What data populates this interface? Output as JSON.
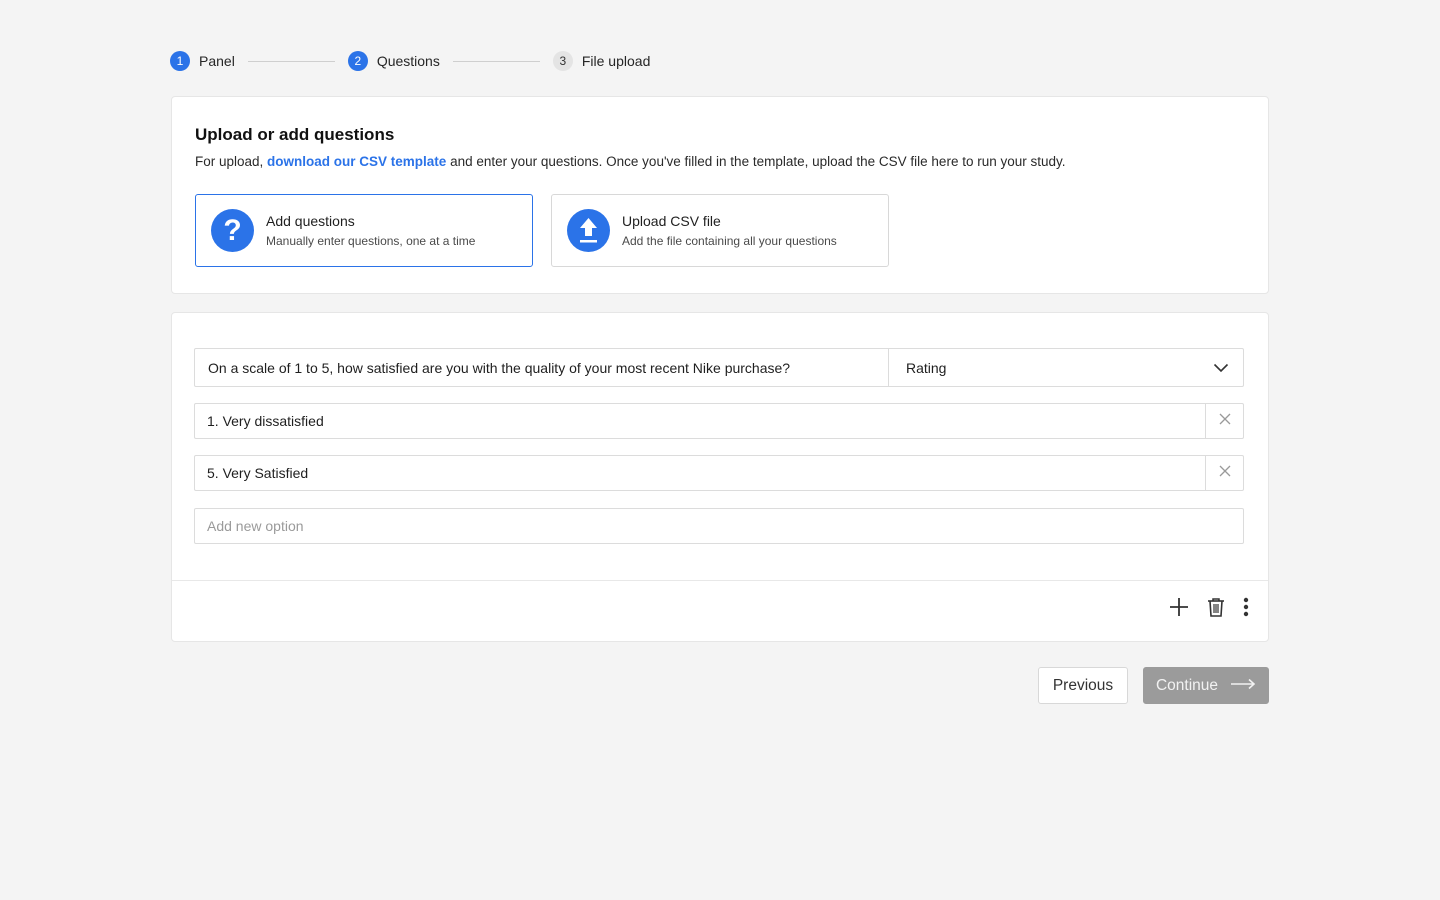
{
  "stepper": {
    "steps": [
      {
        "num": "1",
        "label": "Panel"
      },
      {
        "num": "2",
        "label": "Questions"
      },
      {
        "num": "3",
        "label": "File upload"
      }
    ]
  },
  "upload_card": {
    "title": "Upload or add questions",
    "desc_prefix": "For upload, ",
    "desc_link": "download our CSV template",
    "desc_suffix": " and enter your questions. Once you've filled in the template, upload the CSV file here to run your study.",
    "options": [
      {
        "title": "Add questions",
        "subtitle": "Manually enter questions, one at a time",
        "icon": "question-icon",
        "selected": true
      },
      {
        "title": "Upload CSV file",
        "subtitle": "Add the file containing all your questions",
        "icon": "upload-icon",
        "selected": false
      }
    ]
  },
  "question": {
    "text": "On a scale of 1 to 5, how satisfied are you with the quality of your most recent Nike purchase?",
    "type": "Rating",
    "options": [
      "1. Very dissatisfied",
      "5. Very Satisfied"
    ],
    "new_option_placeholder": "Add new option"
  },
  "footer": {
    "previous_label": "Previous",
    "continue_label": "Continue"
  },
  "colors": {
    "accent": "#2b73e8",
    "disabled_button": "#9b9b9b"
  }
}
